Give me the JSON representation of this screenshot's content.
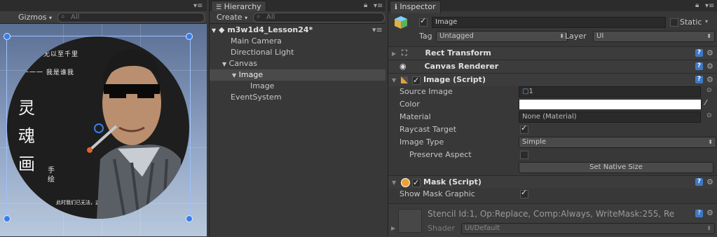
{
  "scene": {
    "gizmos_label": "Gizmos",
    "search_placeholder": "All",
    "calligraphy": {
      "top_line1": "不积跬步无以至千里",
      "top_line2": "一一一 我是谁我",
      "left_big": [
        "灵",
        "魂",
        "画"
      ],
      "left_small": "手 绘",
      "bottom": "此时我们已无法，这是最好的时代"
    }
  },
  "hierarchy": {
    "tab_title": "Hierarchy",
    "create_label": "Create",
    "search_placeholder": "All",
    "scene_name": "m3w1d4_Lesson24*",
    "items": [
      {
        "label": "Main Camera"
      },
      {
        "label": "Directional Light"
      },
      {
        "label": "Canvas"
      },
      {
        "label": "Image"
      },
      {
        "label": "Image"
      },
      {
        "label": "EventSystem"
      }
    ]
  },
  "inspector": {
    "tab_title": "Inspector",
    "object_name": "Image",
    "static_label": "Static",
    "tag_label": "Tag",
    "tag_value": "Untagged",
    "layer_label": "Layer",
    "layer_value": "UI",
    "components": {
      "rect_transform": "Rect Transform",
      "canvas_renderer": "Canvas Renderer",
      "image_script": "Image (Script)",
      "mask_script": "Mask (Script)"
    },
    "image": {
      "source_image_label": "Source Image",
      "source_image_value": "1",
      "color_label": "Color",
      "material_label": "Material",
      "material_value": "None (Material)",
      "raycast_label": "Raycast Target",
      "image_type_label": "Image Type",
      "image_type_value": "Simple",
      "preserve_aspect_label": "Preserve Aspect",
      "set_native_size_label": "Set Native Size"
    },
    "mask": {
      "show_mask_graphic_label": "Show Mask Graphic"
    },
    "material_preview": {
      "stencil_text": "Stencil Id:1, Op:Replace, Comp:Always, WriteMask:255, Re",
      "shader_label": "Shader",
      "shader_value": "UI/Default"
    }
  }
}
